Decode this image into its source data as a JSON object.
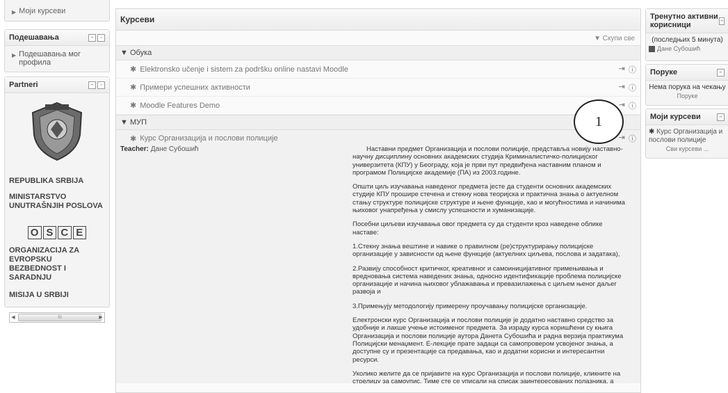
{
  "left": {
    "my_courses_label": "Моји курсеви",
    "settings": {
      "title": "Подешавања",
      "item": "Подешавања мог профила"
    },
    "partners": {
      "title": "Partneri",
      "lines": [
        "REPUBLIKA SRBIJA",
        "MINISTARSTVO UNUTRAŠNJIH POSLOVA"
      ],
      "osce_letters": [
        "O",
        "S",
        "C",
        "E"
      ],
      "org_lines": [
        "ORGANIZACIJA ZA EVROPSKU BEZBEDNOST I SARADNJU",
        "MISIJA U SRBIJI"
      ],
      "scroll_thumb": "III"
    }
  },
  "center": {
    "title": "Курсеви",
    "collapse_all": "Скупи све",
    "categories": [
      {
        "name": "Обука",
        "courses": [
          "Elektronsko učenje i sistem za podršku online nastavi Moodle",
          "Примери успешних активности",
          "Moodle Features Demo"
        ]
      },
      {
        "name": "МУП",
        "expanded_course": {
          "name": "Курс Организација и послови полиције",
          "teacher_label": "Teacher:",
          "teacher_name": "Дане Субошић",
          "summary": [
            "Наставни предмет Организација и послови полиције, представља новију наставно-научну дисциплину основних академских студија Криминалистичко-полицијског универзитета (КПУ) у Београду, која је први пут предвиђена наставним планом и програмом Полицијске академије (ПА) из 2003.године.",
            "Општи циљ изучавања наведеног предмета јесте да студенти основних академских студије КПУ прошире стечена и стекну нова теоријска и практична знања о актуелном стању структуре полицијске структуре и њене функције, као и могућностима и начинима њиховог унапређења у смислу успешности и хуманизације.",
            "Посебни циљеви изучавања овог предмета су да студенти кроз наведене облике наставе:",
            "1.Стекну знања вештине и навике о правилном (ре)структурирању полицијске организације у зависности од њене функције (актуелних циљева, послова и задатака),",
            "2.Развију способност критичког, креативног и самоиницијативног примењивања и вредновања система наведених знања, односно идентификације проблема полицијске организације и начина њиховог ублажавања и превазилажења с циљем њеног даљег развоја и",
            "3.Примењују методологију примерену проучавању полицијске организације.",
            "Електронски курс Организација и послови полиције је додатно наставно средство за удобније и лакше учење истоименог предмета. За израду курса коришћени су књига Организација и послови полиције аутора Данета Субошића и радна верзија практикума Полицијски менаџмент. Е-лекције прате задаци са самопровером усвојеног знања, а доступне су и презентације са предавања, као и додатни корисни и интересантни ресурси.",
            "Уколико желите да се пријавите на курс Организација и послови полиције, кликните на стрелицу за самоупис. Тиме сте се уписали на списак заинтересованих полазника, а тренер ће Вам отварањем корисничког налога, омогућити да похађате овај курс, а томе ћете бити благовремено обавештени."
          ]
        }
      }
    ],
    "callout_number": "1"
  },
  "right": {
    "online": {
      "title": "Тренутно активни корисници",
      "period": "(последњих 5 минута)",
      "user": "Дане Субошић"
    },
    "messages": {
      "title": "Поруке",
      "empty": "Нема порука на чекању",
      "link": "Поруке"
    },
    "my_courses": {
      "title": "Моји курсеви",
      "course": "Курс Организација и послови полиције",
      "all": "Сви курсеви ..."
    }
  }
}
